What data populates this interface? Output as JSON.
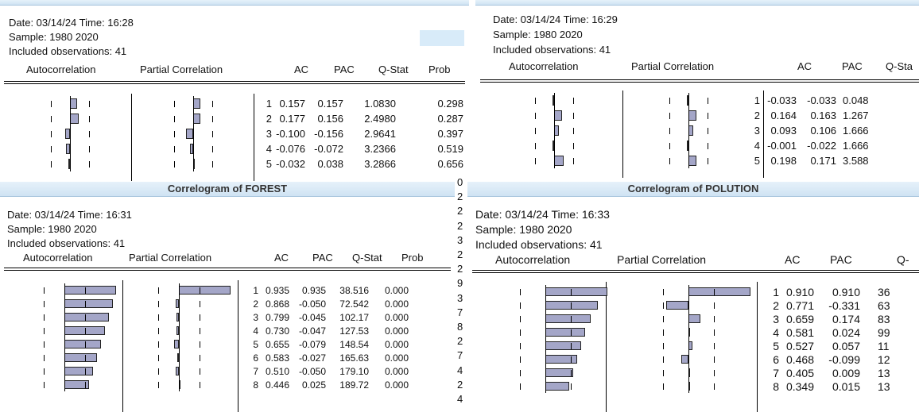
{
  "windows": [
    {
      "id": "w1",
      "title": "",
      "date_line": "Date: 03/14/24   Time: 16:28",
      "sample": "Sample: 1980 2020",
      "obs": "Included observations: 41",
      "col_autocorr": "Autocorrelation",
      "col_partial": "Partial Correlation",
      "col_ac": "AC",
      "col_pac": "PAC",
      "col_q": "Q-Stat",
      "col_prob": "Prob",
      "rows": [
        {
          "lag": "1",
          "ac": "0.157",
          "pac": "0.157",
          "q": "1.0830",
          "prob": "0.298",
          "acv": 0.157,
          "pacv": 0.157
        },
        {
          "lag": "2",
          "ac": "0.177",
          "pac": "0.156",
          "q": "2.4980",
          "prob": "0.287",
          "acv": 0.177,
          "pacv": 0.156
        },
        {
          "lag": "3",
          "ac": "-0.100",
          "pac": "-0.156",
          "q": "2.9641",
          "prob": "0.397",
          "acv": -0.1,
          "pacv": -0.156
        },
        {
          "lag": "4",
          "ac": "-0.076",
          "pac": "-0.072",
          "q": "3.2366",
          "prob": "0.519",
          "acv": -0.076,
          "pacv": -0.072
        },
        {
          "lag": "5",
          "ac": "-0.032",
          "pac": "0.038",
          "q": "3.2866",
          "prob": "0.656",
          "acv": -0.032,
          "pacv": 0.038
        }
      ]
    },
    {
      "id": "w2",
      "title": "",
      "date_line": "Date: 03/14/24   Time: 16:29",
      "sample": "Sample: 1980 2020",
      "obs": "Included observations: 41",
      "col_autocorr": "Autocorrelation",
      "col_partial": "Partial Correlation",
      "col_ac": "AC",
      "col_pac": "PAC",
      "col_q": "Q-Sta",
      "col_prob": "",
      "rows": [
        {
          "lag": "1",
          "ac": "-0.033",
          "pac": "-0.033",
          "q": "0.048",
          "prob": "",
          "acv": -0.033,
          "pacv": -0.033
        },
        {
          "lag": "2",
          "ac": "0.164",
          "pac": "0.163",
          "q": "1.267",
          "prob": "",
          "acv": 0.164,
          "pacv": 0.163
        },
        {
          "lag": "3",
          "ac": "0.093",
          "pac": "0.106",
          "q": "1.666",
          "prob": "",
          "acv": 0.093,
          "pacv": 0.106
        },
        {
          "lag": "4",
          "ac": "-0.001",
          "pac": "-0.022",
          "q": "1.666",
          "prob": "",
          "acv": -0.001,
          "pacv": -0.022
        },
        {
          "lag": "5",
          "ac": "0.198",
          "pac": "0.171",
          "q": "3.588",
          "prob": "",
          "acv": 0.198,
          "pacv": 0.171
        }
      ]
    },
    {
      "id": "w3",
      "title": "Correlogram of FOREST",
      "date_line": "Date: 03/14/24   Time: 16:31",
      "sample": "Sample: 1980 2020",
      "obs": "Included observations: 41",
      "col_autocorr": "Autocorrelation",
      "col_partial": "Partial Correlation",
      "col_ac": "AC",
      "col_pac": "PAC",
      "col_q": "Q-Stat",
      "col_prob": "Prob",
      "rows": [
        {
          "lag": "1",
          "ac": "0.935",
          "pac": "0.935",
          "q": "38.516",
          "prob": "0.000",
          "acv": 0.935,
          "pacv": 0.935
        },
        {
          "lag": "2",
          "ac": "0.868",
          "pac": "-0.050",
          "q": "72.542",
          "prob": "0.000",
          "acv": 0.868,
          "pacv": -0.05
        },
        {
          "lag": "3",
          "ac": "0.799",
          "pac": "-0.045",
          "q": "102.17",
          "prob": "0.000",
          "acv": 0.799,
          "pacv": -0.045
        },
        {
          "lag": "4",
          "ac": "0.730",
          "pac": "-0.047",
          "q": "127.53",
          "prob": "0.000",
          "acv": 0.73,
          "pacv": -0.047
        },
        {
          "lag": "5",
          "ac": "0.655",
          "pac": "-0.079",
          "q": "148.54",
          "prob": "0.000",
          "acv": 0.655,
          "pacv": -0.079
        },
        {
          "lag": "6",
          "ac": "0.583",
          "pac": "-0.027",
          "q": "165.63",
          "prob": "0.000",
          "acv": 0.583,
          "pacv": -0.027
        },
        {
          "lag": "7",
          "ac": "0.510",
          "pac": "-0.050",
          "q": "179.10",
          "prob": "0.000",
          "acv": 0.51,
          "pacv": -0.05
        },
        {
          "lag": "8",
          "ac": "0.446",
          "pac": "0.025",
          "q": "189.72",
          "prob": "0.000",
          "acv": 0.446,
          "pacv": 0.025
        }
      ]
    },
    {
      "id": "w4",
      "title": "Correlogram of POLUTION",
      "date_line": "Date: 03/14/24   Time: 16:33",
      "sample": "Sample: 1980 2020",
      "obs": "Included observations: 41",
      "col_autocorr": "Autocorrelation",
      "col_partial": "Partial Correlation",
      "col_ac": "AC",
      "col_pac": "PAC",
      "col_q": "Q-",
      "col_prob": "",
      "rows": [
        {
          "lag": "1",
          "ac": "0.910",
          "pac": "0.910",
          "q": "36",
          "prob": "",
          "acv": 0.91,
          "pacv": 0.91
        },
        {
          "lag": "2",
          "ac": "0.771",
          "pac": "-0.331",
          "q": "63",
          "prob": "",
          "acv": 0.771,
          "pacv": -0.331
        },
        {
          "lag": "3",
          "ac": "0.659",
          "pac": "0.174",
          "q": "83",
          "prob": "",
          "acv": 0.659,
          "pacv": 0.174
        },
        {
          "lag": "4",
          "ac": "0.581",
          "pac": "0.024",
          "q": "99",
          "prob": "",
          "acv": 0.581,
          "pacv": 0.024
        },
        {
          "lag": "5",
          "ac": "0.527",
          "pac": "0.057",
          "q": "11",
          "prob": "",
          "acv": 0.527,
          "pacv": 0.057
        },
        {
          "lag": "6",
          "ac": "0.468",
          "pac": "-0.099",
          "q": "12",
          "prob": "",
          "acv": 0.468,
          "pacv": -0.099
        },
        {
          "lag": "7",
          "ac": "0.405",
          "pac": "0.009",
          "q": "13",
          "prob": "",
          "acv": 0.405,
          "pacv": 0.009
        },
        {
          "lag": "8",
          "ac": "0.349",
          "pac": "0.015",
          "q": "13",
          "prob": "",
          "acv": 0.349,
          "pacv": 0.015
        }
      ]
    }
  ],
  "background_strip": [
    "0",
    "2",
    "2",
    "2",
    "3",
    "2",
    "2",
    "9",
    "3",
    "7",
    "8",
    "2",
    "7",
    "4",
    "2",
    "4"
  ]
}
